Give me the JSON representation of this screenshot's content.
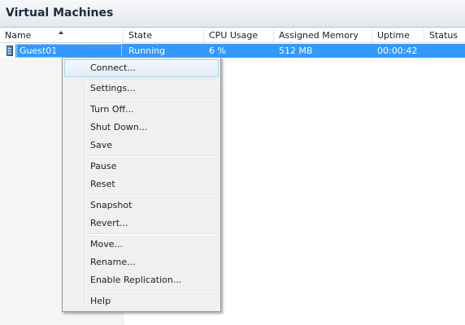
{
  "panel": {
    "title": "Virtual Machines"
  },
  "columns": [
    {
      "label": "Name"
    },
    {
      "label": "State"
    },
    {
      "label": "CPU Usage"
    },
    {
      "label": "Assigned Memory"
    },
    {
      "label": "Uptime"
    },
    {
      "label": "Status"
    }
  ],
  "sort": {
    "column": "Name",
    "direction": "ascending"
  },
  "rows": [
    {
      "name": "Guest01",
      "state": "Running",
      "cpu": "6 %",
      "memory": "512 MB",
      "uptime": "00:00:42",
      "status": "",
      "selected": true,
      "icon": "vm-icon"
    }
  ],
  "context_menu": {
    "items": [
      {
        "label": "Connect...",
        "highlighted": true
      },
      {
        "label": "Settings..."
      },
      {
        "label": "Turn Off..."
      },
      {
        "label": "Shut Down..."
      },
      {
        "label": "Save"
      },
      {
        "label": "Pause"
      },
      {
        "label": "Reset"
      },
      {
        "label": "Snapshot"
      },
      {
        "label": "Revert..."
      },
      {
        "label": "Move..."
      },
      {
        "label": "Rename..."
      },
      {
        "label": "Enable Replication..."
      },
      {
        "label": "Help"
      }
    ]
  },
  "colors": {
    "selection": "#3399ff",
    "menu_background": "#f0f0f0",
    "menu_highlight_border": "#a8d8eb"
  }
}
